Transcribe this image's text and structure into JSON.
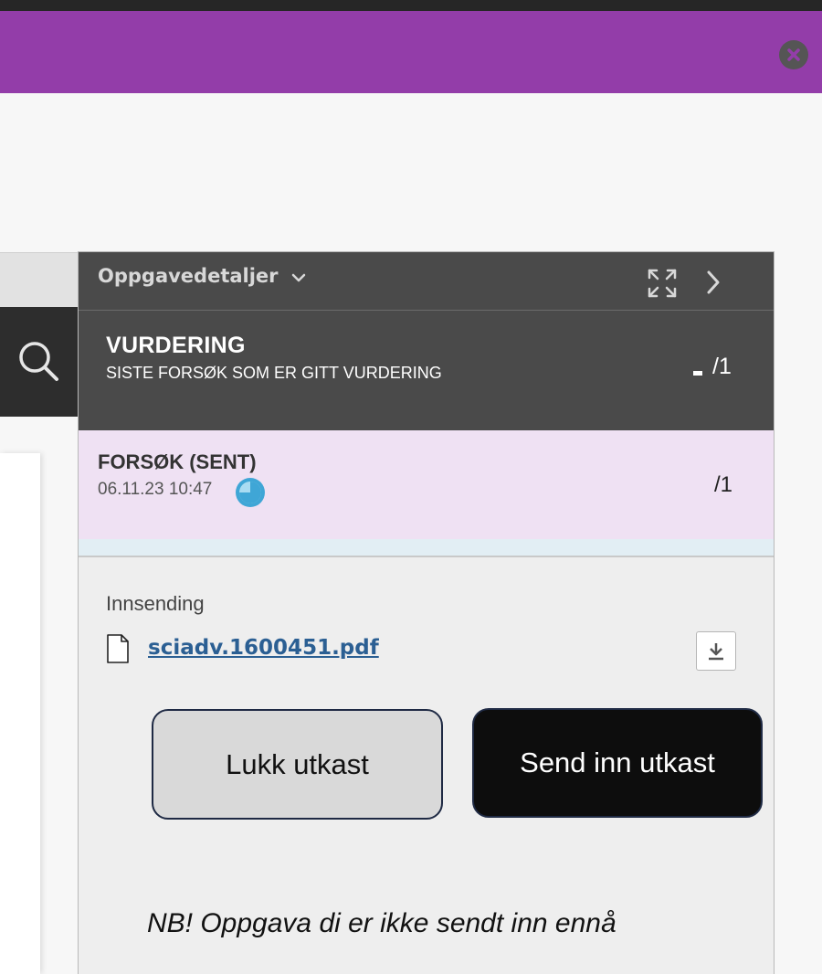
{
  "panel": {
    "title": "Oppgavedetaljer"
  },
  "grade": {
    "title": "VURDERING",
    "subtitle": "SISTE FORSØK SOM ER GITT VURDERING",
    "score": "/1"
  },
  "attempt": {
    "title": "FORSØK (SENT)",
    "datetime": "06.11.23 10:47",
    "score": "/1"
  },
  "submission": {
    "label": "Innsending",
    "file_name": "sciadv.1600451.pdf"
  },
  "buttons": {
    "close_draft": "Lukk utkast",
    "submit_draft": "Send inn utkast"
  },
  "note": "NB! Oppgava di er ikke sendt inn ennå",
  "colors": {
    "purple_bar": "#933da9",
    "panel_dark": "#4a4a4a",
    "attempt_bg": "#efe1f3",
    "link": "#2b5f93",
    "submit_button": "#0d0d0d"
  },
  "icons": [
    "close-icon",
    "chevron-down-icon",
    "expand-icon",
    "chevron-right-icon",
    "search-icon",
    "clock-icon",
    "file-icon",
    "download-icon"
  ]
}
